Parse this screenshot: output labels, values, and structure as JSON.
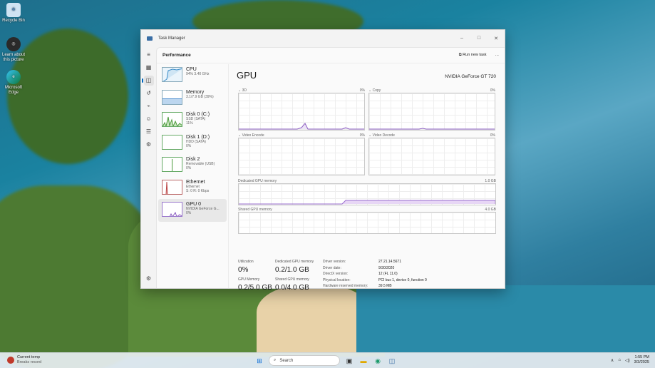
{
  "desktop": {
    "icons": [
      {
        "label": "Recycle Bin"
      },
      {
        "label": "Learn about this picture"
      },
      {
        "label": "Microsoft Edge"
      }
    ]
  },
  "window": {
    "title": "Task Manager",
    "controls": {
      "minimize": "–",
      "maximize": "□",
      "close": "✕"
    }
  },
  "header": {
    "title": "Performance",
    "run_task": "Run new task",
    "more": "···"
  },
  "sidebar": {
    "items": [
      {
        "name": "CPU",
        "sub1": "94% 3.40 GHz",
        "sub2": ""
      },
      {
        "name": "Memory",
        "sub1": "3.1/7.9 GB (39%)",
        "sub2": ""
      },
      {
        "name": "Disk 0 (C:)",
        "sub1": "SSD (SATA)",
        "sub2": "11%"
      },
      {
        "name": "Disk 1 (D:)",
        "sub1": "HDD (SATA)",
        "sub2": "0%"
      },
      {
        "name": "Disk 2",
        "sub1": "Removable (USB)",
        "sub2": "0%"
      },
      {
        "name": "Ethernet",
        "sub1": "Ethernet",
        "sub2": "S: 0 R: 0 Kbps"
      },
      {
        "name": "GPU 0",
        "sub1": "NVIDIA GeForce G...",
        "sub2": "0%"
      }
    ]
  },
  "gpu": {
    "title": "GPU",
    "model": "NVIDIA GeForce GT 720",
    "graphs": [
      {
        "label": "3D",
        "pct": "0%"
      },
      {
        "label": "Copy",
        "pct": "0%"
      },
      {
        "label": "Video Encode",
        "pct": "0%"
      },
      {
        "label": "Video Decode",
        "pct": "0%"
      }
    ],
    "dedicated": {
      "label": "Dedicated GPU memory",
      "max": "1.0 GB"
    },
    "shared": {
      "label": "Shared GPU memory",
      "max": "4.0 GB"
    },
    "stats": {
      "utilization": {
        "label": "Utilization",
        "value": "0%"
      },
      "dedicated_mem": {
        "label": "Dedicated GPU memory",
        "value": "0.2/1.0 GB"
      },
      "gpu_memory": {
        "label": "GPU Memory",
        "value": "0.2/5.0 GB"
      },
      "shared_mem": {
        "label": "Shared GPU memory",
        "value": "0.0/4.0 GB"
      }
    },
    "details": [
      {
        "k": "Driver version:",
        "v": "27.21.14.5671"
      },
      {
        "k": "Driver date:",
        "v": "9/30/2020"
      },
      {
        "k": "DirectX version:",
        "v": "12 (FL 11.0)"
      },
      {
        "k": "Physical location:",
        "v": "PCI bus 1, device 0, function 0"
      },
      {
        "k": "Hardware reserved memory:",
        "v": "39.5 MB"
      }
    ]
  },
  "taskbar": {
    "weather_title": "Current temp",
    "weather_sub": "Breaks record",
    "search": "Search",
    "time": "1:55 PM",
    "date": "3/3/2025"
  }
}
